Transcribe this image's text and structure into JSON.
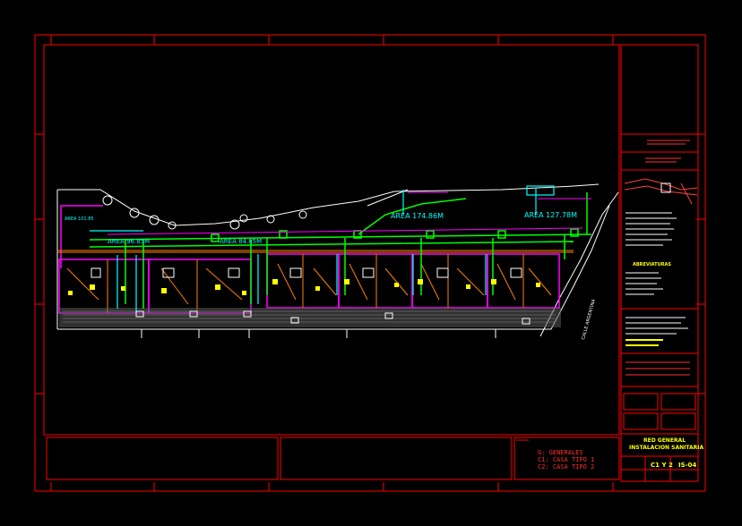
{
  "drawing": {
    "area_labels": [
      "AREA 174.86M",
      "AREA 127.78M",
      "AREA 96.85M",
      "AREA 84.85M",
      "AREA 101.85"
    ],
    "street_label": "CALLE ARGENTINA",
    "section_title": "ABREVIATURAS"
  },
  "title_block": {
    "title_line1": "RED GENERAL",
    "title_line2": "INSTALACION SANITARIA",
    "sheet_code": "C1 Y 2",
    "sheet_number": "IS-04"
  },
  "index": {
    "rows": [
      {
        "code": "G",
        "label": "GENERALES"
      },
      {
        "code": "C1",
        "label": "CASA TIPO 1"
      },
      {
        "code": "C2",
        "label": "CASA TIPO 2"
      }
    ]
  },
  "colors": {
    "background": "#000000",
    "border": "#ff0000",
    "green": "#00ff00",
    "magenta": "#ff00ff",
    "cyan": "#00ffff",
    "yellow": "#ffff00",
    "orange": "#ff8000",
    "white": "#ffffff"
  }
}
